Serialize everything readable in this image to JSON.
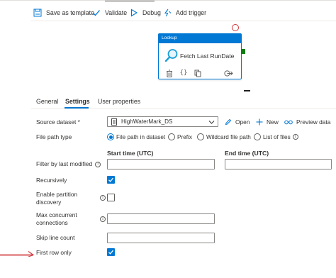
{
  "toolbar": {
    "save_template": "Save as template",
    "validate": "Validate",
    "debug": "Debug",
    "add_trigger": "Add trigger"
  },
  "activity": {
    "type": "Lookup",
    "name": "Fetch Last RunDate"
  },
  "tabs": [
    "General",
    "Settings",
    "User properties"
  ],
  "active_tab": "Settings",
  "form": {
    "source_dataset_label": "Source dataset",
    "required_marker": "*",
    "source_dataset_value": "HighWaterMark_DS",
    "open": "Open",
    "new": "New",
    "preview": "Preview data",
    "file_path_type_label": "File path type",
    "file_path_options": [
      "File path in dataset",
      "Prefix",
      "Wildcard file path",
      "List of files"
    ],
    "file_path_selected": "File path in dataset",
    "filter_label": "Filter by last modified",
    "start_time": "Start time (UTC)",
    "end_time": "End time (UTC)",
    "recursively_label": "Recursively",
    "recursively_checked": true,
    "partition_label_1": "Enable partition",
    "partition_label_2": "discovery",
    "partition_checked": false,
    "max_conn_label_1": "Max concurrent",
    "max_conn_label_2": "connections",
    "skip_line_label": "Skip line count",
    "first_row_label": "First row only",
    "first_row_checked": true
  },
  "colors": {
    "accent": "#0078d4",
    "success_port": "#107c10",
    "error_port": "#d13438",
    "annotation_arrow": "#d13438"
  }
}
